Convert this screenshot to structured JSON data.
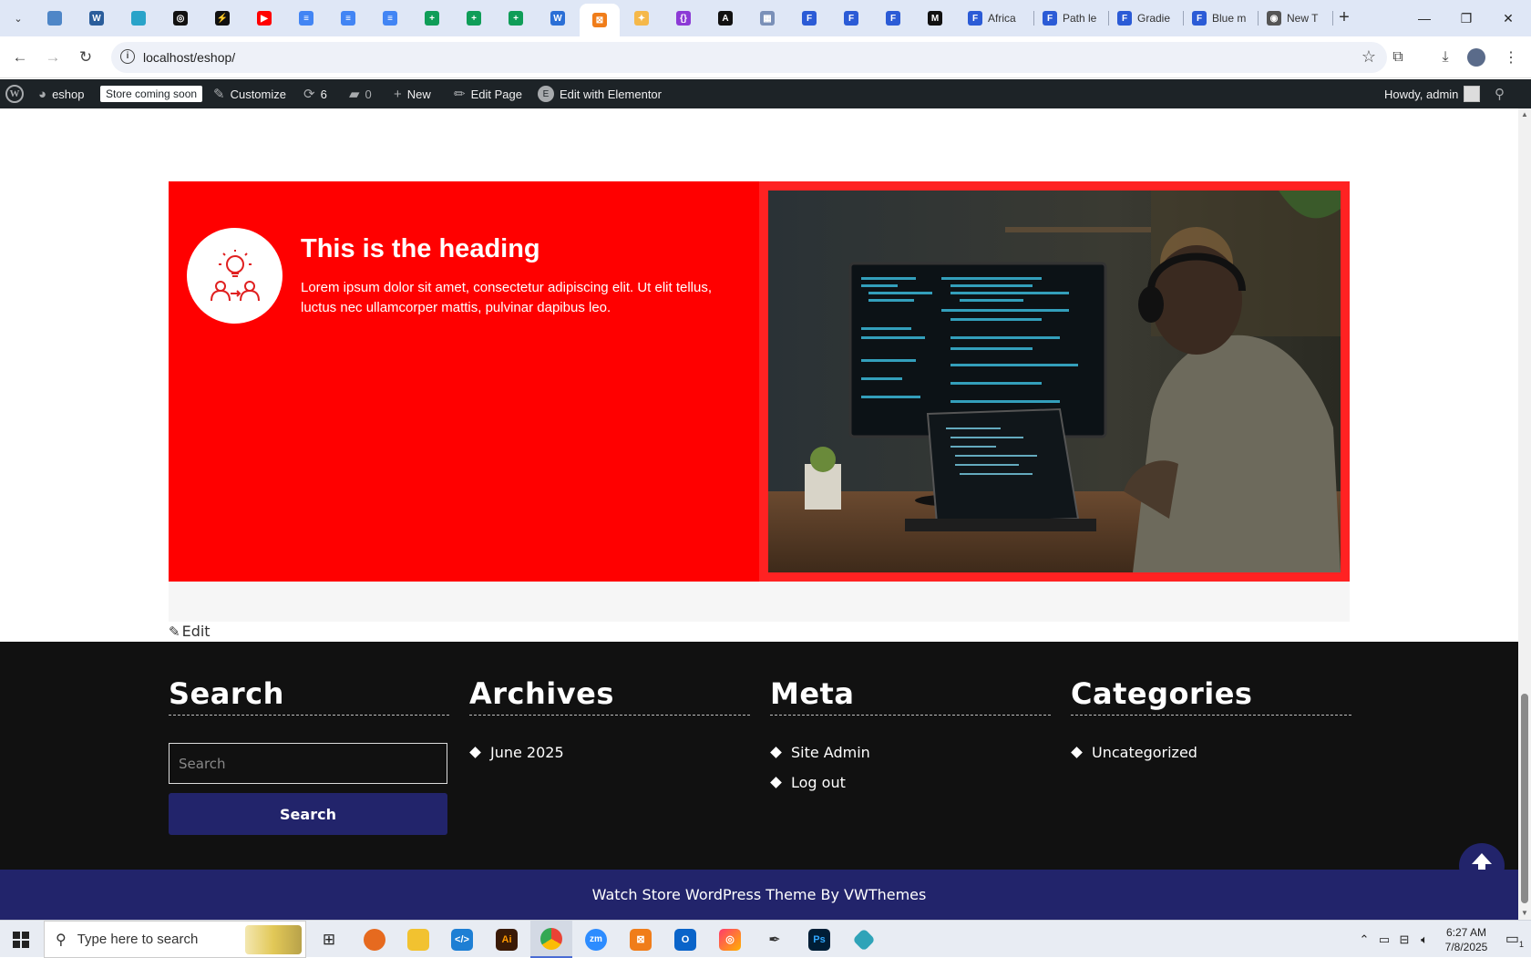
{
  "browser": {
    "tabs": [
      {
        "icon": "edge-icon",
        "color": "#4e86c7",
        "glyph": ""
      },
      {
        "icon": "wordpress-icon",
        "color": "#2a5d9b",
        "glyph": "W"
      },
      {
        "icon": "app-icon",
        "color": "#29a3c9",
        "glyph": ""
      },
      {
        "icon": "openai-icon",
        "color": "#111111",
        "glyph": "◎"
      },
      {
        "icon": "bolt-icon",
        "color": "#111111",
        "glyph": "⚡"
      },
      {
        "icon": "youtube-icon",
        "color": "#ff0000",
        "glyph": "▶"
      },
      {
        "icon": "docs-icon",
        "color": "#4285f4",
        "glyph": "≡"
      },
      {
        "icon": "docs-icon",
        "color": "#4285f4",
        "glyph": "≡"
      },
      {
        "icon": "docs-icon",
        "color": "#4285f4",
        "glyph": "≡"
      },
      {
        "icon": "sheets-icon",
        "color": "#0f9d58",
        "glyph": "+"
      },
      {
        "icon": "sheets-icon",
        "color": "#0f9d58",
        "glyph": "+"
      },
      {
        "icon": "sheets-icon",
        "color": "#0f9d58",
        "glyph": "+"
      },
      {
        "icon": "word-icon",
        "color": "#2b6fd6",
        "glyph": "W"
      },
      {
        "icon": "xampp-icon",
        "color": "#f07d1a",
        "glyph": "⊠",
        "active": true
      },
      {
        "icon": "bird-icon",
        "color": "#f5b84a",
        "glyph": "✦"
      },
      {
        "icon": "code-icon",
        "color": "#8c3ad6",
        "glyph": "{}"
      },
      {
        "icon": "figma-a-icon",
        "color": "#111111",
        "glyph": "A"
      },
      {
        "icon": "grid-icon",
        "color": "#7a90b8",
        "glyph": "▦"
      },
      {
        "icon": "forms-icon",
        "color": "#2b5bd6",
        "glyph": "F"
      },
      {
        "icon": "forms-icon",
        "color": "#2b5bd6",
        "glyph": "F"
      },
      {
        "icon": "forms-icon",
        "color": "#2b5bd6",
        "glyph": "F"
      },
      {
        "icon": "medium-icon",
        "color": "#111111",
        "glyph": "M"
      }
    ],
    "wide_tabs": [
      {
        "label": "Africa",
        "color": "#2b5bd6"
      },
      {
        "label": "Path le",
        "color": "#2b5bd6"
      },
      {
        "label": "Gradie",
        "color": "#2b5bd6"
      },
      {
        "label": "Blue m",
        "color": "#2b5bd6"
      },
      {
        "label": "New T",
        "color": "#555555"
      }
    ],
    "url": "localhost/eshop/"
  },
  "adminbar": {
    "site": "eshop",
    "badge": "Store coming soon",
    "customize": "Customize",
    "updates": "6",
    "comments": "0",
    "new": "New",
    "edit_page": "Edit Page",
    "elementor": "Edit with Elementor",
    "howdy": "Howdy, admin"
  },
  "feature": {
    "heading": "This is the heading",
    "text": "Lorem ipsum dolor sit amet, consectetur adipiscing elit. Ut elit tellus, luctus nec ullamcorper mattis, pulvinar dapibus leo.",
    "bg_color": "#ff0000"
  },
  "edit_link": "Edit",
  "footer": {
    "search": {
      "title": "Search",
      "placeholder": "Search",
      "button": "Search"
    },
    "archives": {
      "title": "Archives",
      "items": [
        "June 2025"
      ]
    },
    "meta": {
      "title": "Meta",
      "items": [
        "Site Admin",
        "Log out"
      ]
    },
    "categories": {
      "title": "Categories",
      "items": [
        "Uncategorized"
      ]
    }
  },
  "copyright": "Watch Store WordPress Theme By VWThemes",
  "taskbar": {
    "search_placeholder": "Type here to search",
    "time": "6:27 AM",
    "date": "7/8/2025",
    "notifications": "1"
  }
}
